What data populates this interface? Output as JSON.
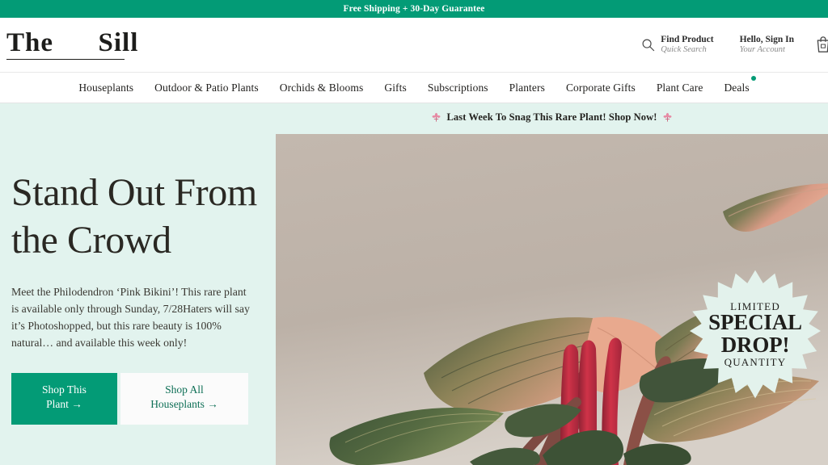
{
  "announcement": {
    "text": "Free Shipping + 30-Day Guarantee",
    "bg_color": "#039b76"
  },
  "header": {
    "logo": "The      Sill",
    "search": {
      "title": "Find Product",
      "subtitle": "Quick Search",
      "icon": "search-icon"
    },
    "account": {
      "title": "Hello, Sign In",
      "subtitle": "Your Account"
    },
    "cart": {
      "icon": "shopping-cart-icon"
    }
  },
  "nav": {
    "items": [
      {
        "label": "Houseplants",
        "badge": false
      },
      {
        "label": "Outdoor & Patio Plants",
        "badge": false
      },
      {
        "label": "Orchids & Blooms",
        "badge": false
      },
      {
        "label": "Gifts",
        "badge": false
      },
      {
        "label": "Subscriptions",
        "badge": false
      },
      {
        "label": "Planters",
        "badge": false
      },
      {
        "label": "Corporate Gifts",
        "badge": false
      },
      {
        "label": "Plant Care",
        "badge": false
      },
      {
        "label": "Deals",
        "badge": true
      }
    ],
    "badge_color": "#039b76"
  },
  "hero": {
    "promo_text": "Last Week To Snag This Rare Plant! Shop Now!",
    "promo_emoji": "blossom-emoji",
    "title": "Stand Out From the Crowd",
    "body": "Meet the Philodendron ‘Pink Bikini’! This rare plant is available only through Sunday, 7/28Haters will say it’s Photoshopped, but this rare beauty is 100% natural… and available this week only!",
    "cta_primary": "Shop This\nPlant →",
    "cta_secondary": "Shop All\nHouseplants →",
    "bg_color": "#e2f3ee",
    "primary_color": "#039b76",
    "image": {
      "alt": "Philodendron Pink Bikini plant with variegated pink and green leaves on taupe background",
      "bg_color": "#bcb1a7"
    },
    "badge": {
      "line1": "LIMITED",
      "line2": "SPECIAL",
      "line3": "DROP!",
      "line4": "QUANTITY",
      "bg_color": "#e3f2ec"
    }
  }
}
